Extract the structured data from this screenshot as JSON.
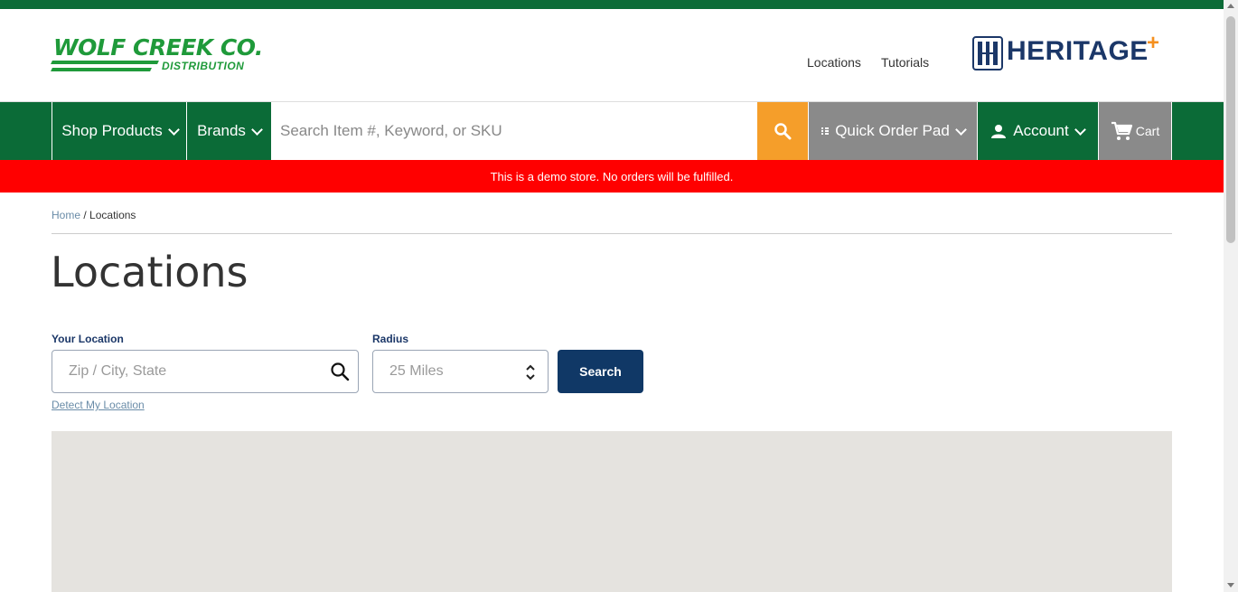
{
  "header": {
    "logo": {
      "main": "WOLF CREEK CO.",
      "sub": "DISTRIBUTION"
    },
    "links": [
      "Locations",
      "Tutorials"
    ],
    "partner_logo": {
      "text": "HERITAGE",
      "plus": "+"
    }
  },
  "nav": {
    "shop_products": "Shop Products",
    "brands": "Brands",
    "search_placeholder": "Search Item #, Keyword, or SKU",
    "quick_order": "Quick Order Pad",
    "account": "Account",
    "cart": "Cart"
  },
  "banner": "This is a demo store. No orders will be fulfilled.",
  "breadcrumb": {
    "home": "Home",
    "separator": "/",
    "current": "Locations"
  },
  "page": {
    "title": "Locations"
  },
  "form": {
    "location_label": "Your Location",
    "location_placeholder": "Zip / City, State",
    "radius_label": "Radius",
    "radius_value": "25 Miles",
    "search_label": "Search",
    "detect_label": "Detect My Location"
  },
  "colors": {
    "brand_green": "#0b6b37",
    "search_orange": "#f59e2a",
    "banner_red": "#ff0000",
    "navy": "#103866",
    "gray_nav": "#8a8a8a"
  }
}
